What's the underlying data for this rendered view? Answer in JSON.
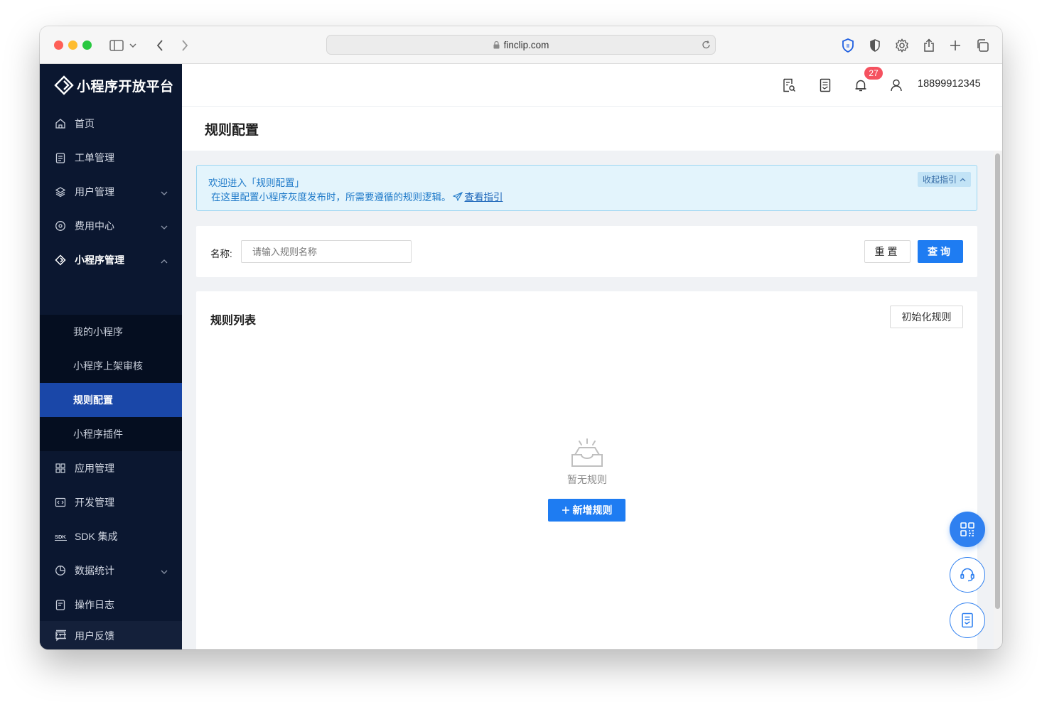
{
  "browser": {
    "url": "finclip.com"
  },
  "app": {
    "logo_text": "小程序开放平台"
  },
  "sidebar": {
    "items": [
      {
        "label": "首页"
      },
      {
        "label": "工单管理"
      },
      {
        "label": "用户管理"
      },
      {
        "label": "费用中心"
      },
      {
        "label": "小程序管理"
      },
      {
        "label": "应用管理"
      },
      {
        "label": "开发管理"
      },
      {
        "label": "SDK 集成"
      },
      {
        "label": "数据统计"
      },
      {
        "label": "操作日志"
      },
      {
        "label": "用户反馈"
      }
    ],
    "submenu": [
      {
        "label": "我的小程序"
      },
      {
        "label": "小程序上架审核"
      },
      {
        "label": "规则配置",
        "active": true
      },
      {
        "label": "小程序插件"
      }
    ]
  },
  "header": {
    "notification_count": "27",
    "username": "18899912345"
  },
  "page": {
    "title": "规则配置"
  },
  "guide": {
    "line1": "欢迎进入「规则配置」",
    "line2": "在这里配置小程序灰度发布时，所需要遵循的规则逻辑。",
    "link": "查看指引",
    "collapse_label": "收起指引"
  },
  "search": {
    "name_label": "名称:",
    "name_placeholder": "请输入规则名称",
    "reset_label": "重置",
    "query_label": "查询"
  },
  "list": {
    "title": "规则列表",
    "init_button": "初始化规则",
    "empty_text": "暂无规则",
    "add_button": "新增规则"
  },
  "colors": {
    "sidebar_bg": "#0b1730",
    "active_item": "#1a47a8",
    "primary": "#1e7cf2",
    "badge": "#f5515f"
  }
}
